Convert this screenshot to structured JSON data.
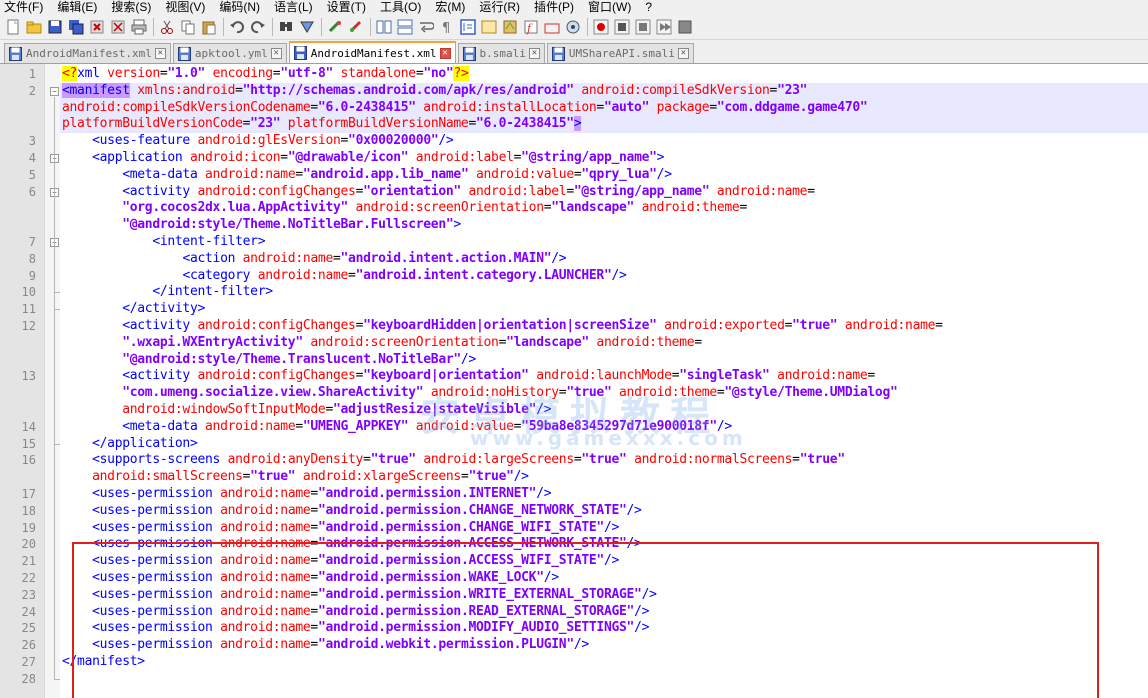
{
  "menu": [
    "文件(F)",
    "编辑(E)",
    "搜索(S)",
    "视图(V)",
    "编码(N)",
    "语言(L)",
    "设置(T)",
    "工具(O)",
    "宏(M)",
    "运行(R)",
    "插件(P)",
    "窗口(W)",
    "?"
  ],
  "tabs": [
    {
      "label": "AndroidManifest.xml",
      "active": false
    },
    {
      "label": "apktool.yml",
      "active": false
    },
    {
      "label": "AndroidManifest.xml",
      "active": true
    },
    {
      "label": "b.smali",
      "active": false
    },
    {
      "label": "UMShareAPI.smali",
      "active": false
    }
  ],
  "watermark": {
    "line1": "安卓模拟教程",
    "line2": "www.gamexxx.com"
  },
  "colors": {
    "tag": "#0000ff",
    "attr": "#ff0000",
    "value": "#8000ff",
    "highlight_box": "#e02020",
    "active_tab_accent": "#f9a23c"
  },
  "lines": [
    {
      "n": "1",
      "text": "<?xml version=\"1.0\" encoding=\"utf-8\" standalone=\"no\"?>"
    },
    {
      "n": "2",
      "text": "<manifest xmlns:android=\"http://schemas.android.com/apk/res/android\" android:compileSdkVersion=\"23\""
    },
    {
      "n": "",
      "text": "android:compileSdkVersionCodename=\"6.0-2438415\" android:installLocation=\"auto\" package=\"com.ddgame.game470\""
    },
    {
      "n": "",
      "text": "platformBuildVersionCode=\"23\" platformBuildVersionName=\"6.0-2438415\">"
    },
    {
      "n": "3",
      "text": "    <uses-feature android:glEsVersion=\"0x00020000\"/>"
    },
    {
      "n": "4",
      "text": "    <application android:icon=\"@drawable/icon\" android:label=\"@string/app_name\">"
    },
    {
      "n": "5",
      "text": "        <meta-data android:name=\"android.app.lib_name\" android:value=\"qpry_lua\"/>"
    },
    {
      "n": "6",
      "text": "        <activity android:configChanges=\"orientation\" android:label=\"@string/app_name\" android:name="
    },
    {
      "n": "",
      "text": "        \"org.cocos2dx.lua.AppActivity\" android:screenOrientation=\"landscape\" android:theme="
    },
    {
      "n": "",
      "text": "        \"@android:style/Theme.NoTitleBar.Fullscreen\">"
    },
    {
      "n": "7",
      "text": "            <intent-filter>"
    },
    {
      "n": "8",
      "text": "                <action android:name=\"android.intent.action.MAIN\"/>"
    },
    {
      "n": "9",
      "text": "                <category android:name=\"android.intent.category.LAUNCHER\"/>"
    },
    {
      "n": "10",
      "text": "            </intent-filter>"
    },
    {
      "n": "11",
      "text": "        </activity>"
    },
    {
      "n": "12",
      "text": "        <activity android:configChanges=\"keyboardHidden|orientation|screenSize\" android:exported=\"true\" android:name="
    },
    {
      "n": "",
      "text": "        \".wxapi.WXEntryActivity\" android:screenOrientation=\"landscape\" android:theme="
    },
    {
      "n": "",
      "text": "        \"@android:style/Theme.Translucent.NoTitleBar\"/>"
    },
    {
      "n": "13",
      "text": "        <activity android:configChanges=\"keyboard|orientation\" android:launchMode=\"singleTask\" android:name="
    },
    {
      "n": "",
      "text": "        \"com.umeng.socialize.view.ShareActivity\" android:noHistory=\"true\" android:theme=\"@style/Theme.UMDialog\""
    },
    {
      "n": "",
      "text": "        android:windowSoftInputMode=\"adjustResize|stateVisible\"/>"
    },
    {
      "n": "14",
      "text": "        <meta-data android:name=\"UMENG_APPKEY\" android:value=\"59ba8e8345297d71e900018f\"/>"
    },
    {
      "n": "15",
      "text": "    </application>"
    },
    {
      "n": "16",
      "text": "    <supports-screens android:anyDensity=\"true\" android:largeScreens=\"true\" android:normalScreens=\"true\""
    },
    {
      "n": "",
      "text": "    android:smallScreens=\"true\" android:xlargeScreens=\"true\"/>"
    },
    {
      "n": "17",
      "text": "    <uses-permission android:name=\"android.permission.INTERNET\"/>"
    },
    {
      "n": "18",
      "text": "    <uses-permission android:name=\"android.permission.CHANGE_NETWORK_STATE\"/>"
    },
    {
      "n": "19",
      "text": "    <uses-permission android:name=\"android.permission.CHANGE_WIFI_STATE\"/>"
    },
    {
      "n": "20",
      "text": "    <uses-permission android:name=\"android.permission.ACCESS_NETWORK_STATE\"/>"
    },
    {
      "n": "21",
      "text": "    <uses-permission android:name=\"android.permission.ACCESS_WIFI_STATE\"/>"
    },
    {
      "n": "22",
      "text": "    <uses-permission android:name=\"android.permission.WAKE_LOCK\"/>"
    },
    {
      "n": "23",
      "text": "    <uses-permission android:name=\"android.permission.WRITE_EXTERNAL_STORAGE\"/>"
    },
    {
      "n": "24",
      "text": "    <uses-permission android:name=\"android.permission.READ_EXTERNAL_STORAGE\"/>"
    },
    {
      "n": "25",
      "text": "    <uses-permission android:name=\"android.permission.MODIFY_AUDIO_SETTINGS\"/>"
    },
    {
      "n": "26",
      "text": "    <uses-permission android:name=\"android.webkit.permission.PLUGIN\"/>"
    },
    {
      "n": "27",
      "text": "</manifest>"
    },
    {
      "n": "28",
      "text": ""
    }
  ]
}
